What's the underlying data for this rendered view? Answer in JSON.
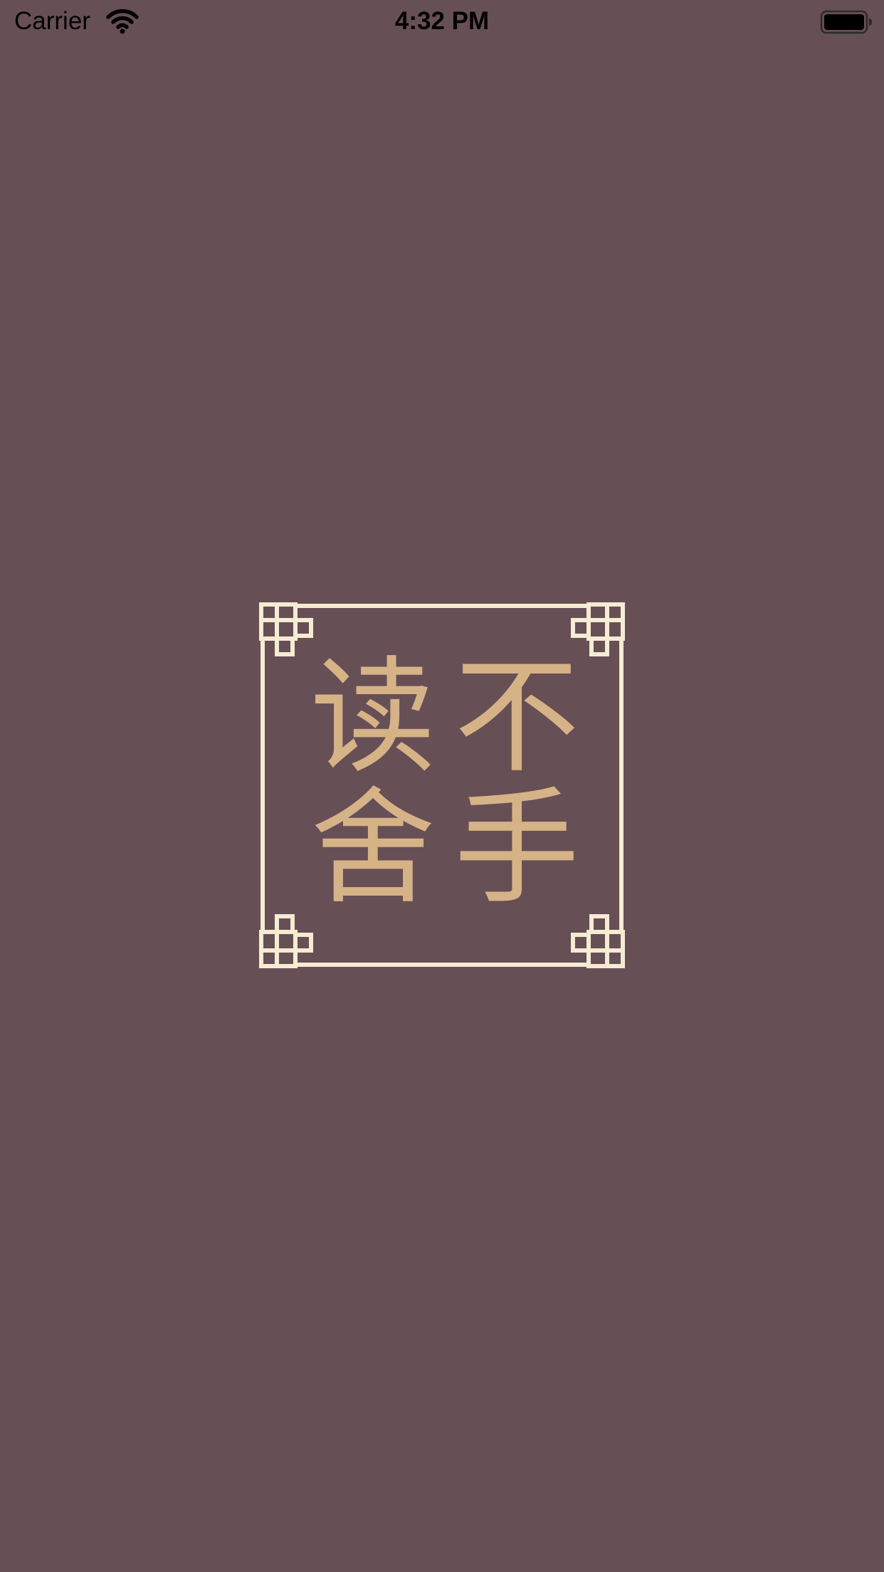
{
  "status_bar": {
    "carrier": "Carrier",
    "time": "4:32 PM",
    "icons": [
      "wifi-icon",
      "battery-icon"
    ]
  },
  "logo": {
    "characters": [
      "读",
      "不",
      "舍",
      "手"
    ]
  },
  "colors": {
    "background": "#674f56",
    "frame": "#f5ecd2",
    "glyph": "#d6b287"
  }
}
